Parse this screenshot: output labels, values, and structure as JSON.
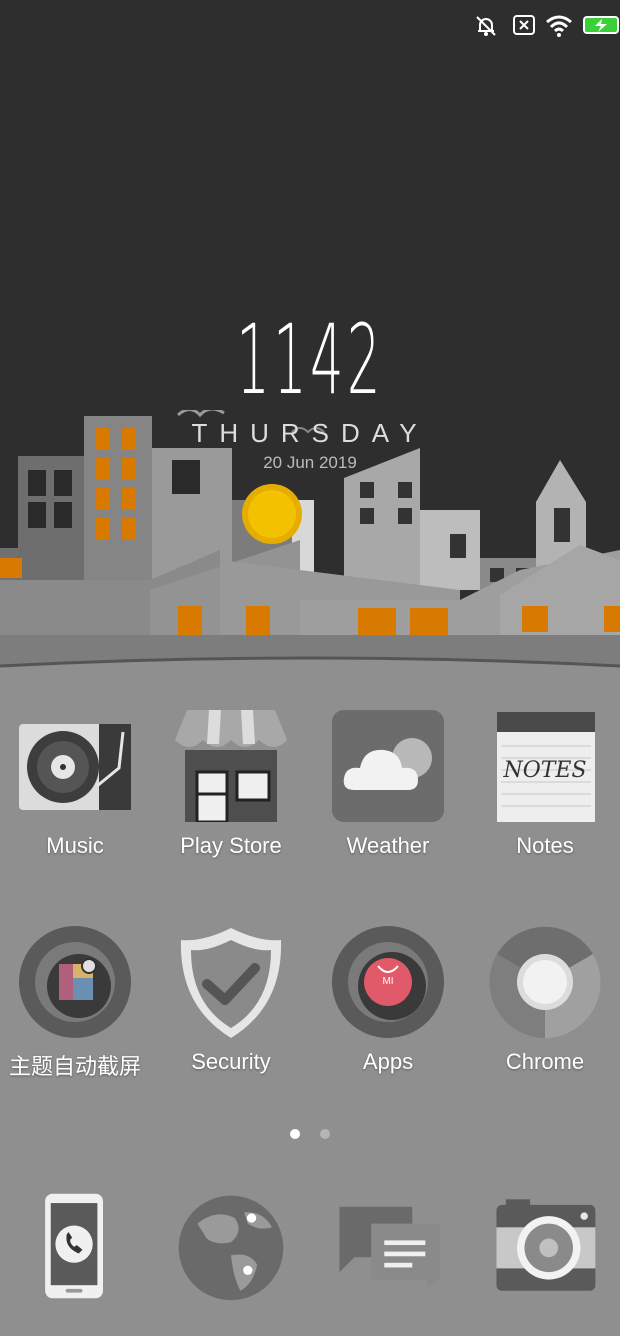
{
  "status_bar": {
    "icons": [
      "bell-off-icon",
      "sim-x-icon",
      "wifi-icon",
      "battery-charging-icon"
    ],
    "battery_color": "#3ccf3c"
  },
  "clock": {
    "time": "1142",
    "day": "THURSDAY",
    "date": "20 Jun 2019"
  },
  "home": {
    "row1": [
      {
        "label": "Music",
        "icon": "turntable-icon"
      },
      {
        "label": "Play Store",
        "icon": "storefront-icon"
      },
      {
        "label": "Weather",
        "icon": "cloud-icon"
      },
      {
        "label": "Notes",
        "icon": "notepad-icon"
      }
    ],
    "row2": [
      {
        "label": "主题自动截屏",
        "icon": "screenshot-icon"
      },
      {
        "label": "Security",
        "icon": "shield-check-icon"
      },
      {
        "label": "Apps",
        "icon": "mi-bag-icon"
      },
      {
        "label": "Chrome",
        "icon": "chrome-icon"
      }
    ],
    "notes_text": "NOTES",
    "mi_text": "MI"
  },
  "page_indicator": {
    "pages": 2,
    "current": 1
  },
  "dock": [
    {
      "icon": "phone-icon"
    },
    {
      "icon": "globe-icon"
    },
    {
      "icon": "messages-icon"
    },
    {
      "icon": "camera-icon"
    }
  ],
  "colors": {
    "window_orange": "#d97a00",
    "sun": "#f2c200",
    "mi_red": "#e05a6a"
  }
}
